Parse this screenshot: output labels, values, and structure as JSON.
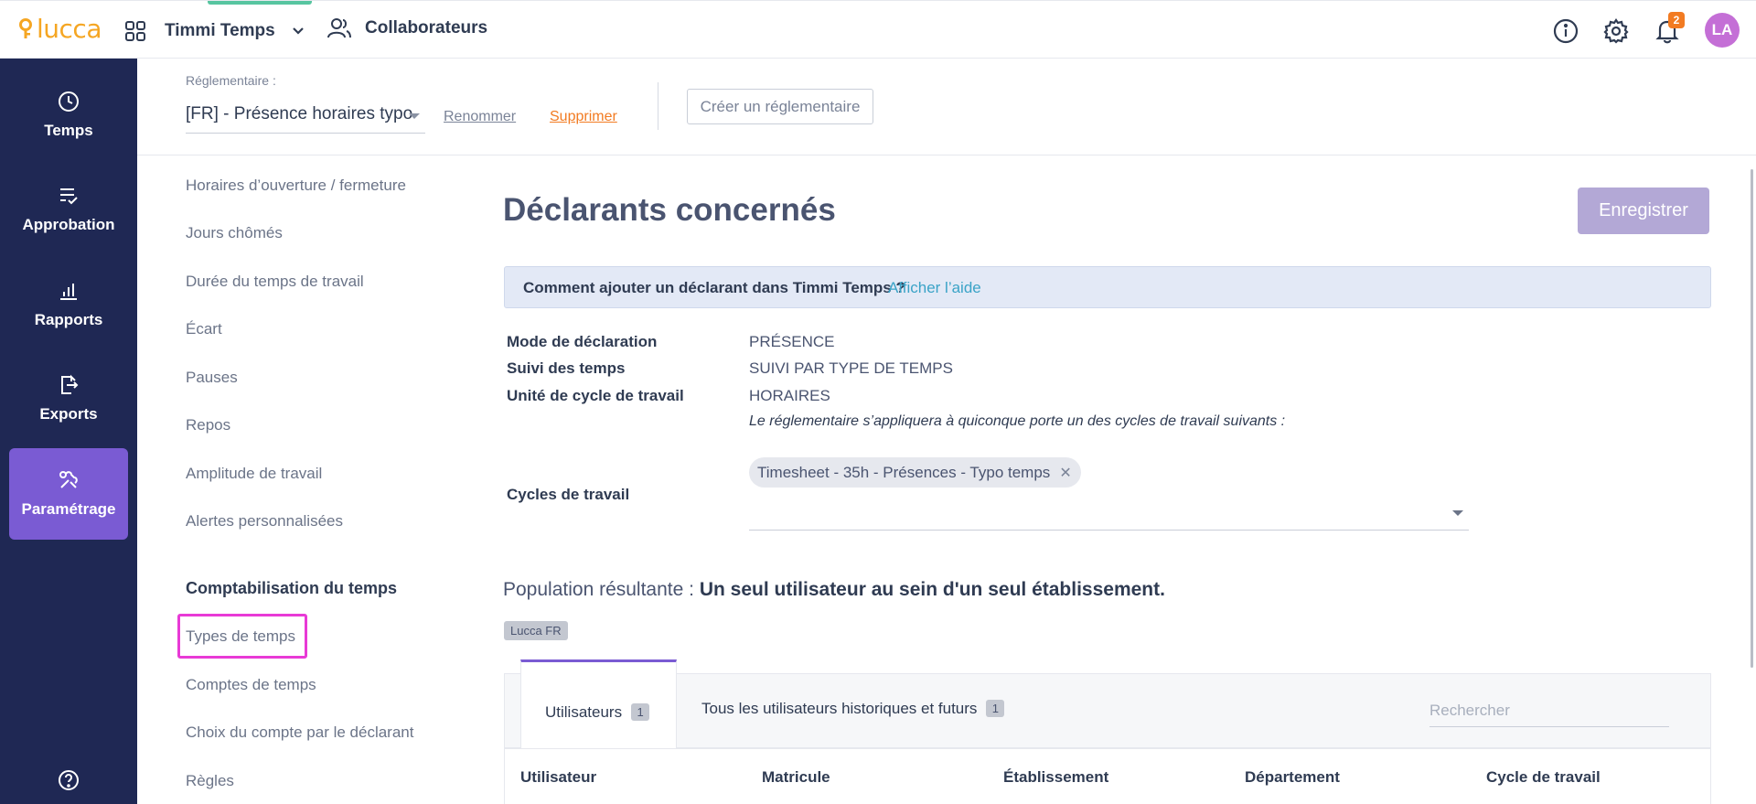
{
  "topbar": {
    "logo_text": "lucca",
    "app_name": "Timmi Temps",
    "collab_label": "Collaborateurs",
    "notification_count": "2",
    "avatar_initials": "LA",
    "icons": [
      "apps-grid-icon",
      "chevron-down-icon",
      "people-icon",
      "info-icon",
      "gear-icon",
      "bell-icon"
    ]
  },
  "sidebar": {
    "items": [
      {
        "label": "Temps",
        "icon": "clock-icon"
      },
      {
        "label": "Approbation",
        "icon": "checklist-icon"
      },
      {
        "label": "Rapports",
        "icon": "chart-icon"
      },
      {
        "label": "Exports",
        "icon": "export-icon"
      },
      {
        "label": "Paramétrage",
        "icon": "tools-icon",
        "active": true
      }
    ],
    "help_icon": "help-icon"
  },
  "reglementaire": {
    "label": "Réglementaire :",
    "selected": "[FR] - Présence horaires typo",
    "rename": "Renommer",
    "delete": "Supprimer",
    "create": "Créer un réglementaire"
  },
  "subnav": {
    "items": [
      "Horaires d’ouverture / fermeture",
      "Jours chômés",
      "Durée du temps de travail",
      "Écart",
      "Pauses",
      "Repos",
      "Amplitude de travail",
      "Alertes personnalisées"
    ],
    "heading": "Comptabilisation du temps",
    "items2": [
      "Types de temps",
      "Comptes de temps",
      "Choix du compte par le déclarant",
      "Règles"
    ]
  },
  "main": {
    "title": "Déclarants concernés",
    "save": "Enregistrer",
    "info_question": "Comment ajouter un déclarant dans Timmi Temps ?",
    "info_help": "Afficher l’aide",
    "fields": [
      {
        "label": "Mode de déclaration",
        "value": "PRÉSENCE"
      },
      {
        "label": "Suivi des temps",
        "value": "SUIVI PAR TYPE DE TEMPS"
      },
      {
        "label": "Unité de cycle de travail",
        "value": "HORAIRES"
      }
    ],
    "note": "Le réglementaire s’appliquera à quiconque porte un des cycles de travail suivants :",
    "cycles_label": "Cycles de travail",
    "cycle_chip": "Timesheet - 35h - Présences - Typo temps",
    "population_prefix": "Population résultante :",
    "population_value": "Un seul utilisateur au sein d'un seul établissement.",
    "tag": "Lucca FR",
    "tabs": [
      {
        "label": "Utilisateurs",
        "count": "1"
      },
      {
        "label": "Tous les utilisateurs historiques et futurs",
        "count": "1"
      }
    ],
    "search_placeholder": "Rechercher",
    "columns": [
      "Utilisateur",
      "Matricule",
      "Établissement",
      "Département",
      "Cycle de travail"
    ]
  },
  "colors": {
    "sidebar_bg": "#1f2854",
    "accent_purple": "#7a5bd3",
    "brand_orange": "#f5a623",
    "link_blue": "#3aa3c7",
    "highlight_magenta": "#e83ad6"
  }
}
